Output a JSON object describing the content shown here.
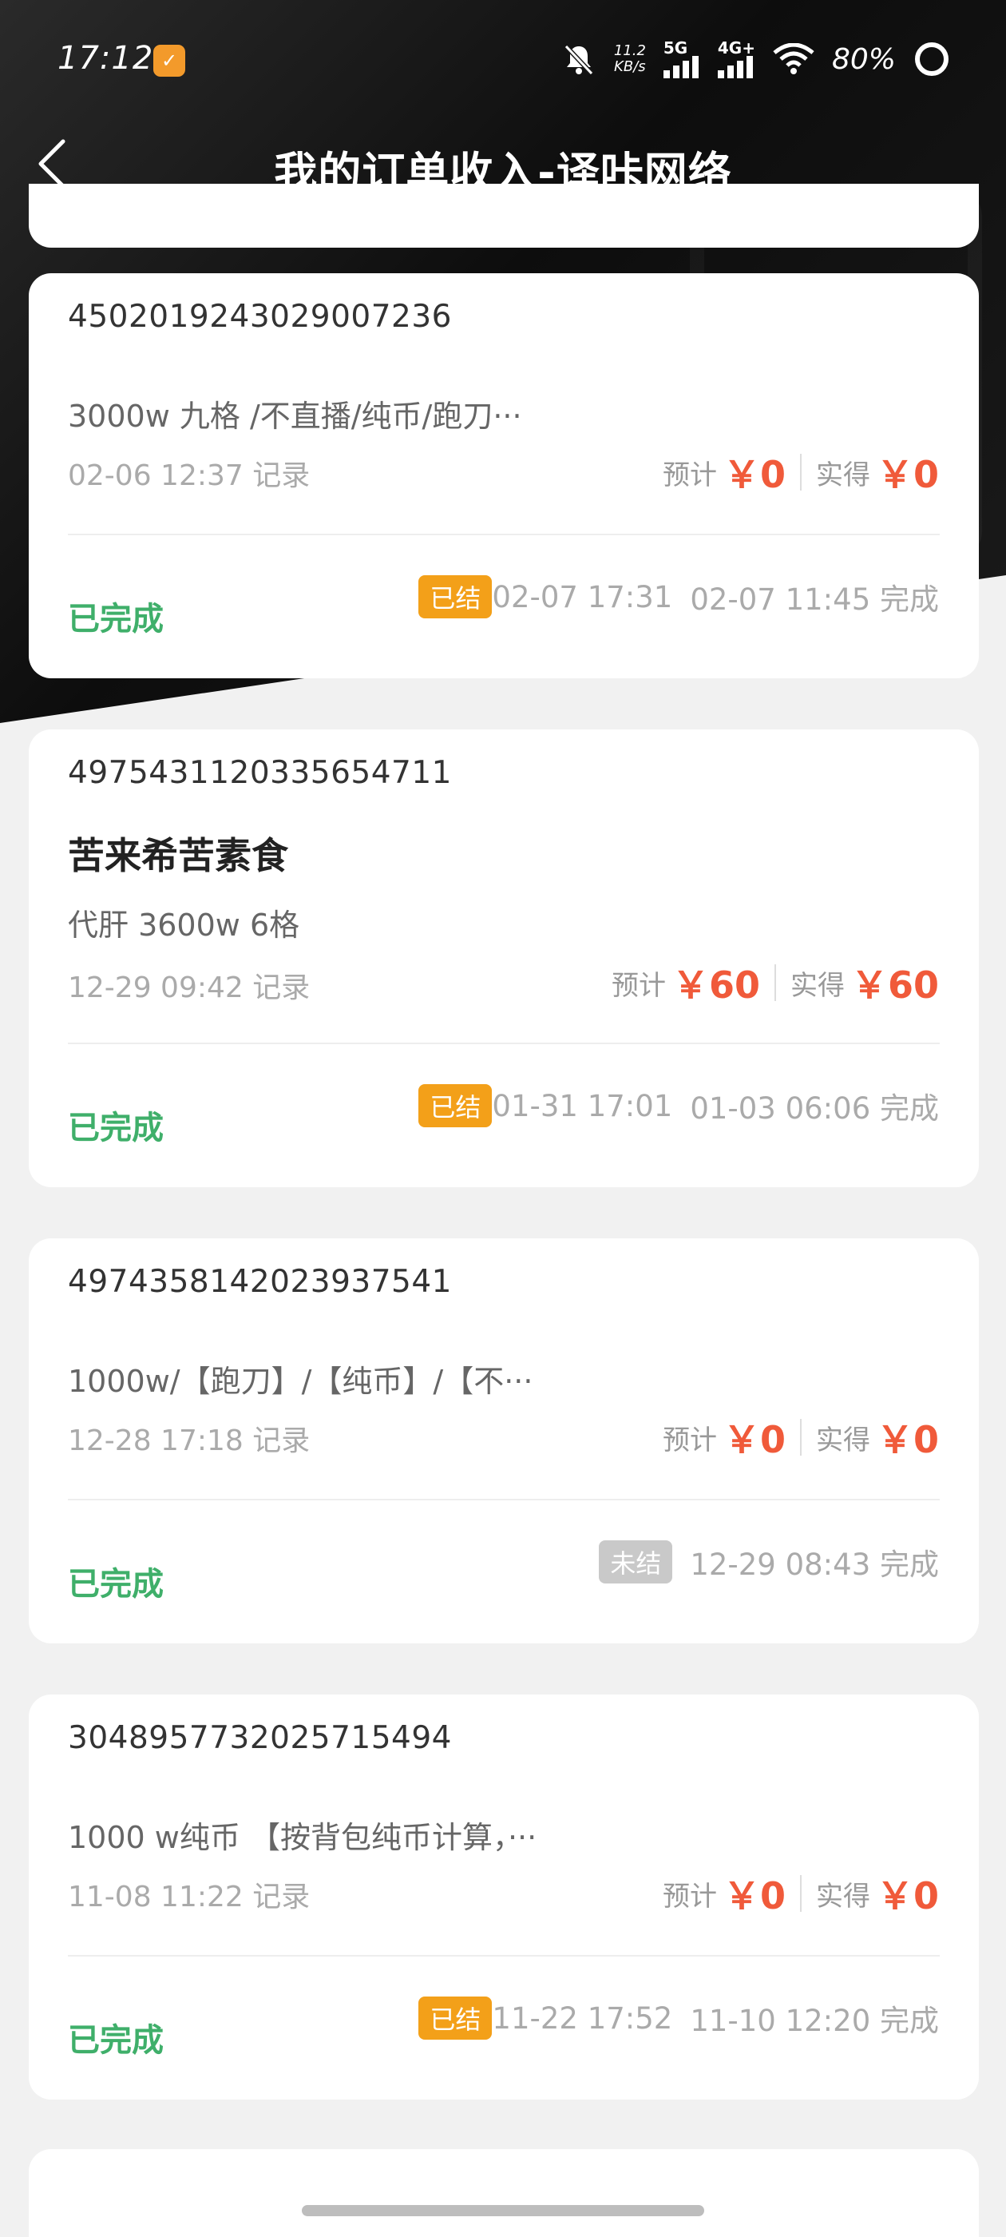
{
  "status_bar": {
    "time": "17:12",
    "net_speed_value": "11.2",
    "net_speed_unit": "KB/s",
    "net_5g": "5G",
    "net_4g": "4G+",
    "battery": "80%"
  },
  "nav": {
    "title": "我的订单收入-译咔网络"
  },
  "orders": [
    {
      "order_no": "4502019243029007236",
      "shop": "",
      "desc": "3000w 九格 /不直播/纯币/跑刀···",
      "record": "02-06 12:37 记录",
      "est_label": "预计",
      "est_value": "￥0",
      "actual_label": "实得",
      "actual_value": "￥0",
      "status": "已完成",
      "settle": "已结",
      "settle_time": "02-07 17:31",
      "complete_time": "02-07 11:45 完成"
    },
    {
      "order_no": "4975431120335654711",
      "shop": "苦来希苦素食",
      "desc": "代肝 3600w 6格",
      "record": "12-29 09:42 记录",
      "est_label": "预计",
      "est_value": "￥60",
      "actual_label": "实得",
      "actual_value": "￥60",
      "status": "已完成",
      "settle": "已结",
      "settle_time": "01-31 17:01",
      "complete_time": "01-03 06:06 完成"
    },
    {
      "order_no": "4974358142023937541",
      "shop": "",
      "desc": "1000w/【跑刀】/【纯币】/【不···",
      "record": "12-28 17:18 记录",
      "est_label": "预计",
      "est_value": "￥0",
      "actual_label": "实得",
      "actual_value": "￥0",
      "status": "已完成",
      "settle": "未结",
      "settle_time": "",
      "complete_time": "12-29 08:43 完成"
    },
    {
      "order_no": "3048957732025715494",
      "shop": "",
      "desc": "1000 w纯币 【按背包纯币计算，···",
      "record": "11-08 11:22 记录",
      "est_label": "预计",
      "est_value": "￥0",
      "actual_label": "实得",
      "actual_value": "￥0",
      "status": "已完成",
      "settle": "已结",
      "settle_time": "11-22 17:52",
      "complete_time": "11-10 12:20 完成"
    }
  ],
  "colors": {
    "accent_red": "#f05a3a",
    "status_green": "#3faf6a",
    "badge_orange": "#f3a019",
    "badge_gray": "#c9c9c9"
  }
}
